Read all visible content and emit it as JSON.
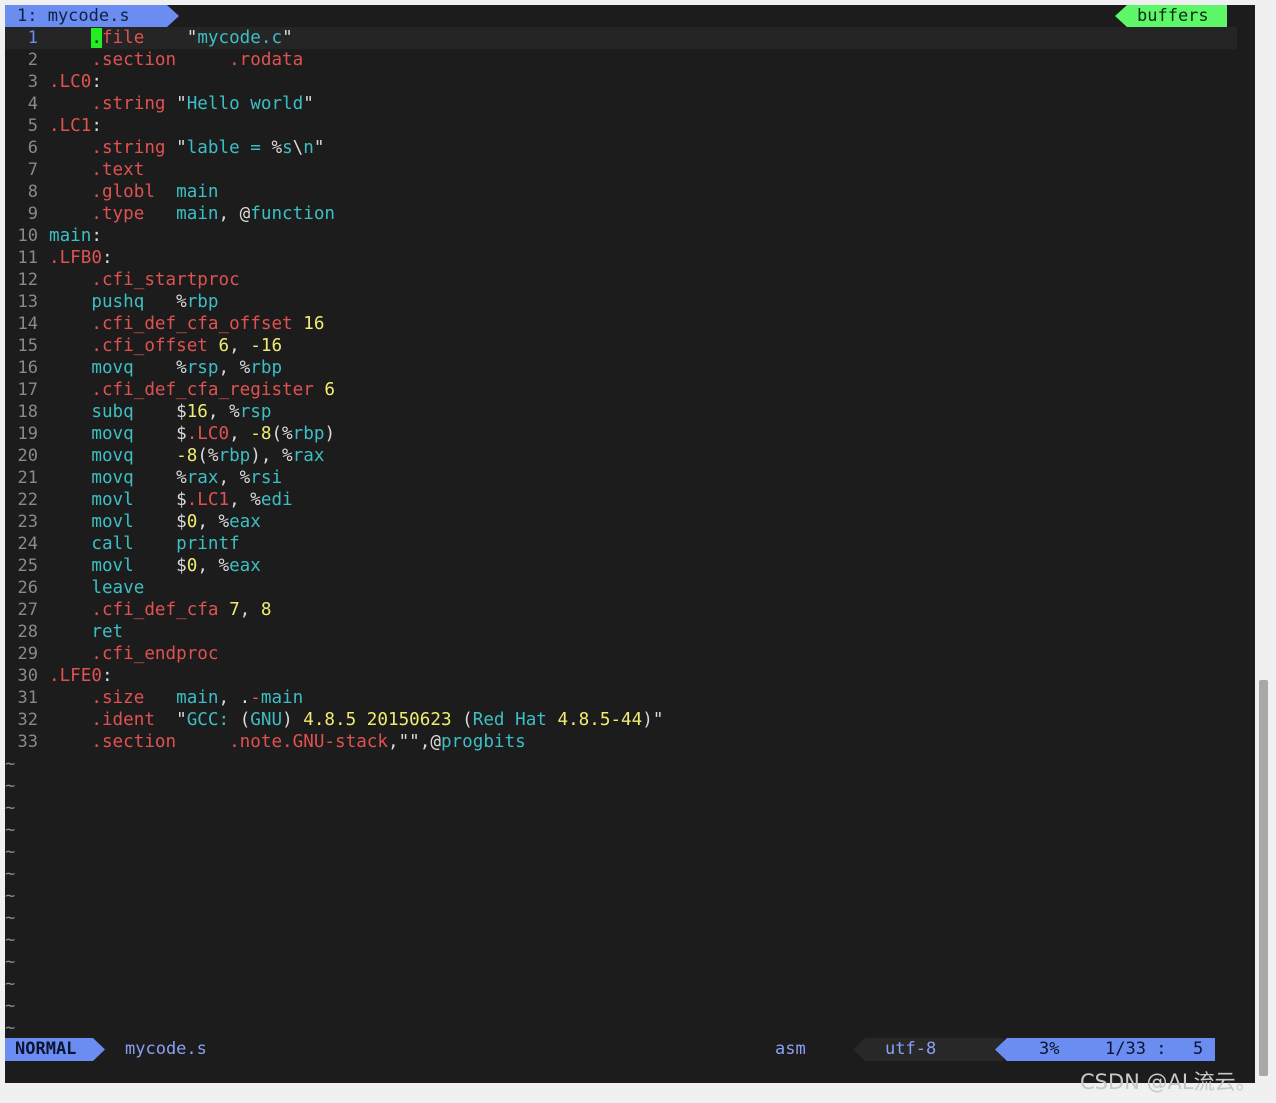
{
  "tabline": {
    "active_tab": "1: mycode.s",
    "right_label": "buffers"
  },
  "buffer": {
    "lines": [
      [
        [
          "cursor",
          "."
        ],
        [
          "d",
          "file"
        ],
        [
          "p",
          "    "
        ],
        [
          "p",
          "\""
        ],
        [
          "k",
          "mycode.c"
        ],
        [
          "p",
          "\""
        ]
      ],
      [
        [
          "d",
          ".section"
        ],
        [
          "p",
          "     "
        ],
        [
          "d",
          ".rodata"
        ]
      ],
      [
        [
          "d",
          ".LC0"
        ],
        [
          "p",
          ":"
        ]
      ],
      [
        [
          "d",
          ".string"
        ],
        [
          "p",
          " \""
        ],
        [
          "k",
          "Hello world"
        ],
        [
          "p",
          "\""
        ]
      ],
      [
        [
          "d",
          ".LC1"
        ],
        [
          "p",
          ":"
        ]
      ],
      [
        [
          "d",
          ".string"
        ],
        [
          "p",
          " \""
        ],
        [
          "k",
          "lable = "
        ],
        [
          "p",
          "%"
        ],
        [
          "k",
          "s"
        ],
        [
          "p",
          "\\"
        ],
        [
          "k",
          "n"
        ],
        [
          "p",
          "\""
        ]
      ],
      [
        [
          "d",
          ".text"
        ]
      ],
      [
        [
          "d",
          ".globl"
        ],
        [
          "p",
          "  "
        ],
        [
          "k",
          "main"
        ]
      ],
      [
        [
          "d",
          ".type"
        ],
        [
          "p",
          "   "
        ],
        [
          "k",
          "main"
        ],
        [
          "p",
          ", @"
        ],
        [
          "k",
          "function"
        ]
      ],
      [
        [
          "k",
          "main"
        ],
        [
          "p",
          ":"
        ]
      ],
      [
        [
          "d",
          ".LFB0"
        ],
        [
          "p",
          ":"
        ]
      ],
      [
        [
          "d",
          ".cfi_startproc"
        ]
      ],
      [
        [
          "t",
          "pushq"
        ],
        [
          "p",
          "   %"
        ],
        [
          "k",
          "rbp"
        ]
      ],
      [
        [
          "d",
          ".cfi_def_cfa_offset"
        ],
        [
          "p",
          " "
        ],
        [
          "n",
          "16"
        ]
      ],
      [
        [
          "d",
          ".cfi_offset"
        ],
        [
          "p",
          " "
        ],
        [
          "n",
          "6"
        ],
        [
          "p",
          ", "
        ],
        [
          "n",
          "-16"
        ]
      ],
      [
        [
          "t",
          "movq"
        ],
        [
          "p",
          "    %"
        ],
        [
          "k",
          "rsp"
        ],
        [
          "p",
          ", %"
        ],
        [
          "k",
          "rbp"
        ]
      ],
      [
        [
          "d",
          ".cfi_def_cfa_register"
        ],
        [
          "p",
          " "
        ],
        [
          "n",
          "6"
        ]
      ],
      [
        [
          "t",
          "subq"
        ],
        [
          "p",
          "    $"
        ],
        [
          "n",
          "16"
        ],
        [
          "p",
          ", %"
        ],
        [
          "k",
          "rsp"
        ]
      ],
      [
        [
          "t",
          "movq"
        ],
        [
          "p",
          "    $"
        ],
        [
          "d",
          ".LC0"
        ],
        [
          "p",
          ", "
        ],
        [
          "n",
          "-8"
        ],
        [
          "p",
          "(%"
        ],
        [
          "k",
          "rbp"
        ],
        [
          "p",
          ")"
        ]
      ],
      [
        [
          "t",
          "movq"
        ],
        [
          "p",
          "    "
        ],
        [
          "n",
          "-8"
        ],
        [
          "p",
          "(%"
        ],
        [
          "k",
          "rbp"
        ],
        [
          "p",
          "), %"
        ],
        [
          "k",
          "rax"
        ]
      ],
      [
        [
          "t",
          "movq"
        ],
        [
          "p",
          "    %"
        ],
        [
          "k",
          "rax"
        ],
        [
          "p",
          ", %"
        ],
        [
          "k",
          "rsi"
        ]
      ],
      [
        [
          "t",
          "movl"
        ],
        [
          "p",
          "    $"
        ],
        [
          "d",
          ".LC1"
        ],
        [
          "p",
          ", %"
        ],
        [
          "k",
          "edi"
        ]
      ],
      [
        [
          "t",
          "movl"
        ],
        [
          "p",
          "    $"
        ],
        [
          "n",
          "0"
        ],
        [
          "p",
          ", %"
        ],
        [
          "k",
          "eax"
        ]
      ],
      [
        [
          "t",
          "call"
        ],
        [
          "p",
          "    "
        ],
        [
          "k",
          "printf"
        ]
      ],
      [
        [
          "t",
          "movl"
        ],
        [
          "p",
          "    $"
        ],
        [
          "n",
          "0"
        ],
        [
          "p",
          ", %"
        ],
        [
          "k",
          "eax"
        ]
      ],
      [
        [
          "t",
          "leave"
        ]
      ],
      [
        [
          "d",
          ".cfi_def_cfa"
        ],
        [
          "p",
          " "
        ],
        [
          "n",
          "7"
        ],
        [
          "p",
          ", "
        ],
        [
          "n",
          "8"
        ]
      ],
      [
        [
          "t",
          "ret"
        ]
      ],
      [
        [
          "d",
          ".cfi_endproc"
        ]
      ],
      [
        [
          "d",
          ".LFE0"
        ],
        [
          "p",
          ":"
        ]
      ],
      [
        [
          "d",
          ".size"
        ],
        [
          "p",
          "   "
        ],
        [
          "k",
          "main"
        ],
        [
          "p",
          ", ."
        ],
        [
          "d",
          "-"
        ],
        [
          "k",
          "main"
        ]
      ],
      [
        [
          "d",
          ".ident"
        ],
        [
          "p",
          "  \""
        ],
        [
          "k",
          "GCC: "
        ],
        [
          "p",
          "("
        ],
        [
          "k",
          "GNU"
        ],
        [
          "p",
          ") "
        ],
        [
          "n",
          "4.8.5 20150623"
        ],
        [
          "p",
          " ("
        ],
        [
          "k",
          "Red Hat "
        ],
        [
          "n",
          "4.8.5-44"
        ],
        [
          "p",
          ")\""
        ]
      ],
      [
        [
          "d",
          ".section"
        ],
        [
          "p",
          "     "
        ],
        [
          "d",
          ".note.GNU-stack"
        ],
        [
          "p",
          ",\"\",@"
        ],
        [
          "k",
          "progbits"
        ]
      ]
    ],
    "indented": [
      true,
      true,
      false,
      true,
      false,
      true,
      true,
      true,
      true,
      false,
      false,
      true,
      true,
      true,
      true,
      true,
      true,
      true,
      true,
      true,
      true,
      true,
      true,
      true,
      true,
      true,
      true,
      true,
      true,
      false,
      true,
      true,
      true
    ],
    "current_line": 1,
    "empty_marker": "~",
    "empty_count": 13
  },
  "statusline": {
    "mode": "NORMAL",
    "filename": "mycode.s",
    "filetype": "asm",
    "encoding": "utf-8",
    "percent": "3%",
    "line_total": "1/33",
    "separator": ":",
    "column": "5"
  },
  "watermark": "CSDN @AL流云。",
  "colors": {
    "background": "#1c1c1c",
    "directive": "#e05252",
    "identifier": "#3cbfc4",
    "number": "#f1ec6f",
    "accent": "#6b8df2",
    "buffers_tab": "#5ff76a",
    "cursor": "#22ee22"
  }
}
